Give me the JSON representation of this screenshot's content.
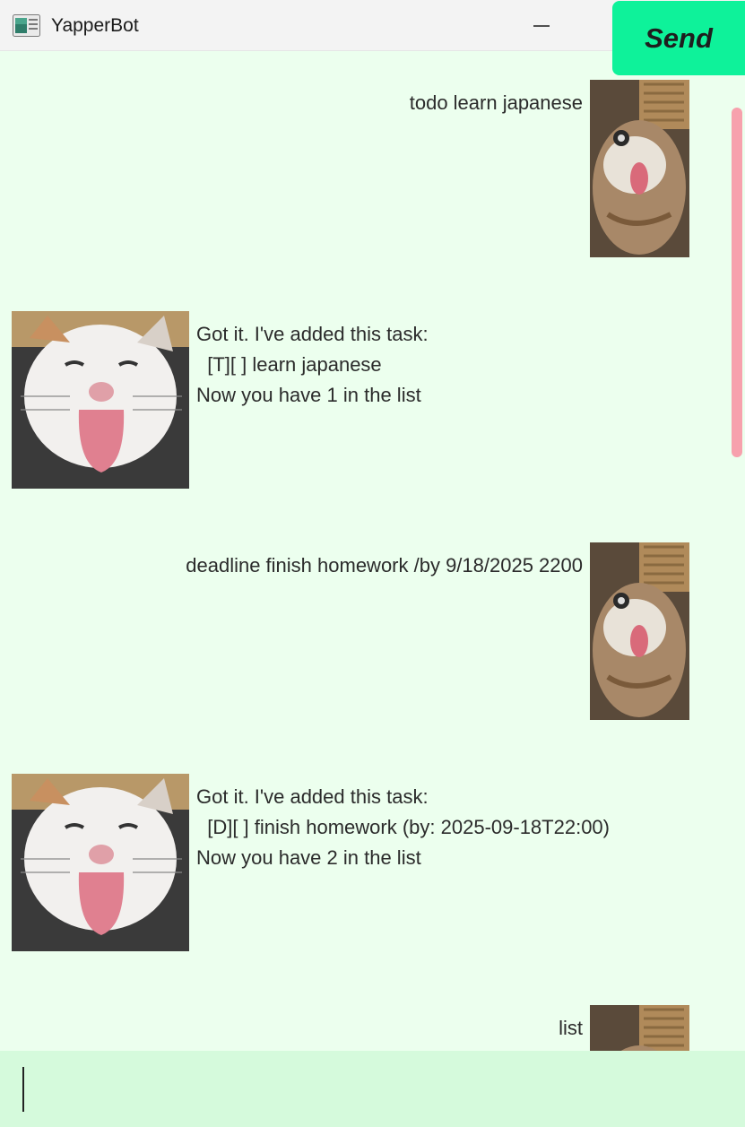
{
  "window": {
    "title": "YapperBot",
    "app_icon": "app-window-icon"
  },
  "controls": {
    "minimize_icon": "minimize-icon",
    "maximize_icon": "maximize-icon",
    "close_icon": "close-icon"
  },
  "messages": [
    {
      "sender": "user",
      "text": "todo learn japanese",
      "avatar": "user-cat-avatar"
    },
    {
      "sender": "bot",
      "lines": [
        "Got it. I've added this task:",
        "  [T][ ] learn japanese",
        "Now you have 1 in the list"
      ],
      "avatar": "bot-cat-avatar"
    },
    {
      "sender": "user",
      "text": "deadline finish homework /by 9/18/2025 2200",
      "avatar": "user-cat-avatar"
    },
    {
      "sender": "bot",
      "lines": [
        "Got it. I've added this task:",
        "  [D][ ] finish homework (by: 2025-09-18T22:00)",
        "Now you have 2 in the list"
      ],
      "avatar": "bot-cat-avatar"
    },
    {
      "sender": "user",
      "text": "list",
      "avatar": "user-cat-avatar"
    }
  ],
  "input": {
    "value": "",
    "placeholder": ""
  },
  "send_button": {
    "label": "Send"
  },
  "colors": {
    "chat_bg": "#ecffee",
    "input_bg": "#d5fadc",
    "send_bg": "#0ef29a",
    "scrollbar": "#f7a1ad"
  }
}
